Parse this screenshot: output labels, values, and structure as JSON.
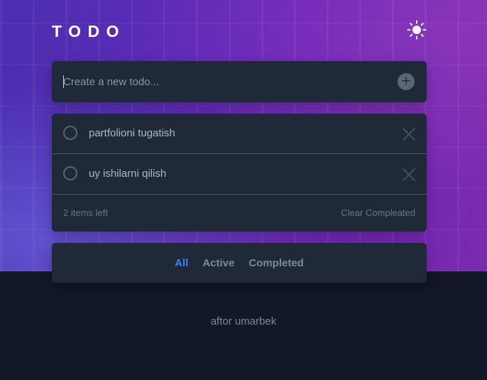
{
  "header": {
    "title": "TODO",
    "theme_icon": "sun-icon"
  },
  "new_todo": {
    "placeholder": "Create a new todo...",
    "value": "",
    "add_icon": "plus-icon",
    "add_label": "+"
  },
  "todos": [
    {
      "text": "partfolioni tugatish",
      "completed": false
    },
    {
      "text": "uy ishilarni qilish",
      "completed": false
    }
  ],
  "list_footer": {
    "items_left": "2 items left",
    "clear_label": "Clear Compleated"
  },
  "filters": {
    "all": "All",
    "active": "Active",
    "completed": "Completed",
    "selected": "All"
  },
  "credit": "aftor umarbek",
  "colors": {
    "accent": "#3b82f6",
    "card": "#1f2937",
    "page_bg": "#111827"
  }
}
